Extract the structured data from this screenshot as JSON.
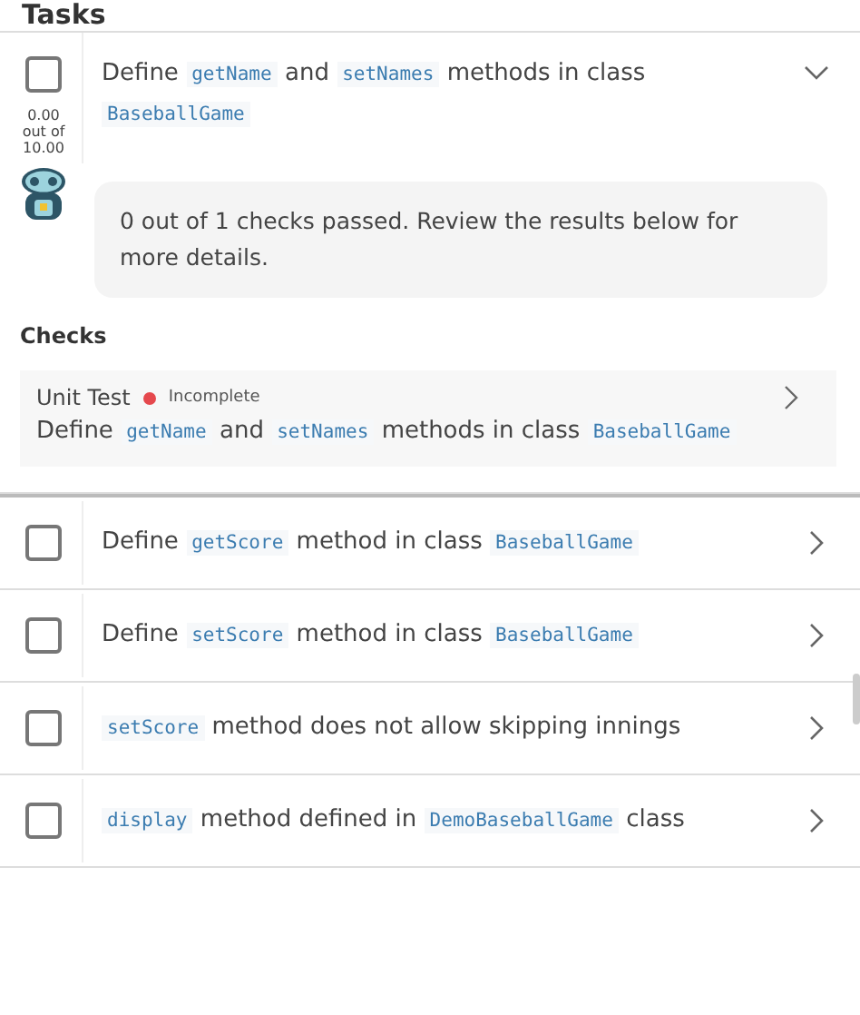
{
  "heading": "Tasks",
  "tasks": [
    {
      "checked": false,
      "expanded": true,
      "score_lines": [
        "0.00",
        "out of",
        "10.00"
      ],
      "title": [
        {
          "kind": "text",
          "text": "Define"
        },
        {
          "kind": "code",
          "text": "getName"
        },
        {
          "kind": "text",
          "text": "and"
        },
        {
          "kind": "code",
          "text": "setNames"
        },
        {
          "kind": "text",
          "text": "methods in class"
        },
        {
          "kind": "code",
          "text": "BaseballGame"
        }
      ],
      "feedback": "0 out of 1 checks passed. Review the results below for more details.",
      "checks_heading": "Checks",
      "checks": [
        {
          "type": "Unit Test",
          "status": "Incomplete",
          "color": "#e5484d",
          "title": [
            {
              "kind": "text",
              "text": "Define"
            },
            {
              "kind": "code",
              "text": "getName"
            },
            {
              "kind": "text",
              "text": "and"
            },
            {
              "kind": "code",
              "text": "setNames"
            },
            {
              "kind": "text",
              "text": "methods in class"
            },
            {
              "kind": "code",
              "text": "BaseballGame"
            }
          ]
        }
      ]
    },
    {
      "checked": false,
      "expanded": false,
      "title": [
        {
          "kind": "text",
          "text": "Define"
        },
        {
          "kind": "code",
          "text": "getScore"
        },
        {
          "kind": "text",
          "text": "method in class"
        },
        {
          "kind": "code",
          "text": "BaseballGame"
        }
      ]
    },
    {
      "checked": false,
      "expanded": false,
      "title": [
        {
          "kind": "text",
          "text": "Define"
        },
        {
          "kind": "code",
          "text": "setScore"
        },
        {
          "kind": "text",
          "text": "method in class"
        },
        {
          "kind": "code",
          "text": "BaseballGame"
        }
      ]
    },
    {
      "checked": false,
      "expanded": false,
      "title": [
        {
          "kind": "code",
          "text": "setScore"
        },
        {
          "kind": "text",
          "text": "method does not allow skipping innings"
        }
      ]
    },
    {
      "checked": false,
      "expanded": false,
      "title": [
        {
          "kind": "code",
          "text": "display"
        },
        {
          "kind": "text",
          "text": "method defined in"
        },
        {
          "kind": "code",
          "text": "DemoBaseballGame"
        },
        {
          "kind": "text",
          "text": "class"
        }
      ]
    }
  ]
}
